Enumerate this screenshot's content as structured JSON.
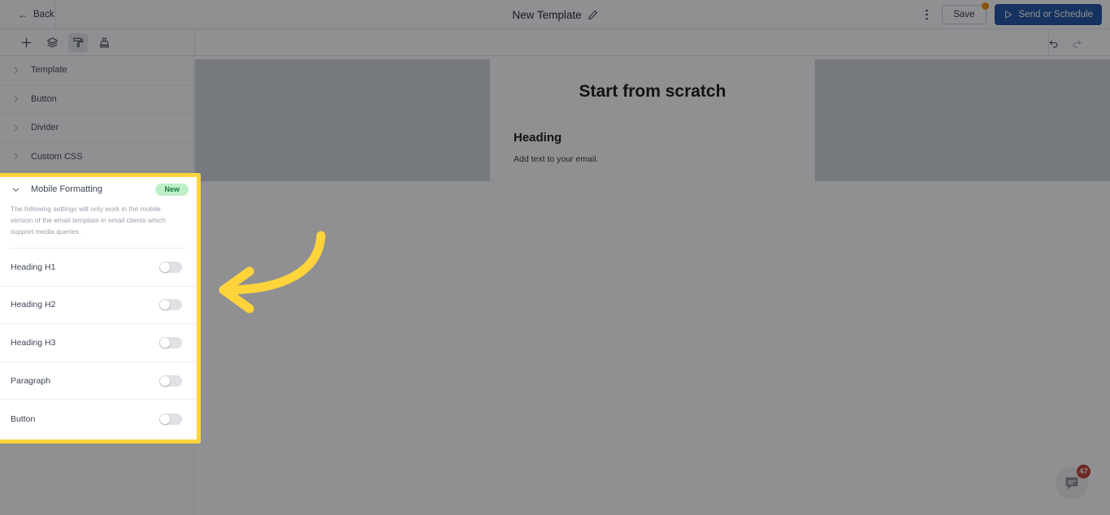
{
  "topbar": {
    "back_label": "Back",
    "title": "New Template",
    "edit_icon": "pencil-icon",
    "menu_icon": "kebab-menu-icon",
    "save_label": "Save",
    "save_badge_color": "#f08c00",
    "send_label": "Send or Schedule",
    "send_icon": "send-triangle-icon",
    "send_color": "#1a4fa0"
  },
  "toolbar": {
    "items": [
      {
        "name": "add-block-icon",
        "label": "Add",
        "active": false
      },
      {
        "name": "layers-icon",
        "label": "Layers",
        "active": false
      },
      {
        "name": "paint-roller-icon",
        "label": "Styles",
        "active": true
      },
      {
        "name": "stamp-icon",
        "label": "Saved blocks",
        "active": false
      }
    ],
    "undo_icon": "undo-icon",
    "redo_icon": "redo-icon"
  },
  "sidebar": {
    "accordions": [
      {
        "label": "Template",
        "expanded": false
      },
      {
        "label": "Button",
        "expanded": false
      },
      {
        "label": "Divider",
        "expanded": false
      },
      {
        "label": "Custom CSS",
        "expanded": false
      }
    ]
  },
  "mobile_formatting": {
    "title": "Mobile Formatting",
    "badge": "New",
    "badge_color": "#bdf0c8",
    "expanded": true,
    "description": "The following settings will only work in the mobile version of the email template in email clients which support media queries.",
    "toggles": [
      {
        "label": "Heading H1",
        "on": false
      },
      {
        "label": "Heading H2",
        "on": false
      },
      {
        "label": "Heading H3",
        "on": false
      },
      {
        "label": "Paragraph",
        "on": false
      },
      {
        "label": "Button",
        "on": false
      }
    ],
    "highlight_color": "#ffd43b"
  },
  "canvas": {
    "scratch_title": "Start from scratch",
    "heading": "Heading",
    "paragraph": "Add text to your email."
  },
  "chat": {
    "icon": "chat-bubble-icon",
    "unread_count": "47",
    "badge_color": "#c0392b"
  },
  "annotation": {
    "arrow": "curved-left-arrow",
    "color": "#ffd43b"
  }
}
